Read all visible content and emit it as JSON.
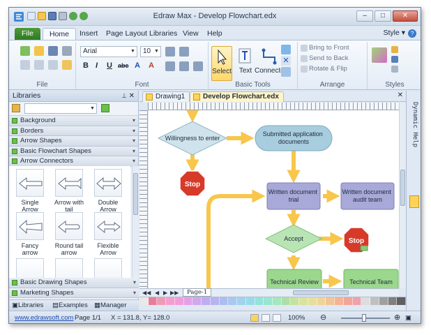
{
  "window": {
    "title": "Edraw Max - Develop Flowchart.edx",
    "controls": {
      "minimize": "–",
      "maximize": "□",
      "close": "✕"
    }
  },
  "ribbon_tabs": [
    "File",
    "Home",
    "Insert",
    "Page Layout",
    "Libraries",
    "View",
    "Help"
  ],
  "active_tab": "Home",
  "style_menu": "Style",
  "help_icon": "?",
  "ribbon": {
    "groups": {
      "file": "File",
      "font": "Font",
      "basic_tools": "Basic Tools",
      "arrange": "Arrange",
      "styles": "Styles"
    },
    "font_name": "Arial",
    "font_size": "10",
    "format_buttons": [
      "B",
      "I",
      "U",
      "abc",
      "A",
      "A"
    ],
    "tools": {
      "select": "Select",
      "text": "Text",
      "connector": "Connector"
    },
    "arrange": {
      "bring_to_front": "Bring to Front",
      "send_to_back": "Send to Back",
      "rotate_flip": "Rotate & Flip"
    }
  },
  "libraries": {
    "title": "Libraries",
    "categories_top": [
      "Background",
      "Borders",
      "Arrow Shapes",
      "Basic Flowchart Shapes",
      "Arrow Connectors"
    ],
    "shapes": [
      {
        "label": "Single Arrow"
      },
      {
        "label": "Arrow with tail"
      },
      {
        "label": "Double Arrow"
      },
      {
        "label": "Fancy arrow"
      },
      {
        "label": "Round tail arrow"
      },
      {
        "label": "Flexible Arrow"
      }
    ],
    "categories_bottom": [
      "Basic Drawing Shapes",
      "Marketing Shapes"
    ],
    "tabs": [
      "Libraries",
      "Examples",
      "Manager"
    ]
  },
  "doc_tabs": [
    "Drawing1",
    "Develop Flowchart.edx"
  ],
  "active_doc": "Develop Flowchart.edx",
  "dynamic_help": "Dynamic Help",
  "page_tab": "Page-1",
  "flowchart": {
    "nodes": {
      "willingness": "Willingness to enter",
      "submitted": "Submitted application documents",
      "stop1": "Stop",
      "written_trial": "Written document trial",
      "written_audit": "Written document audit team",
      "accept": "Accept",
      "stop2": "Stop",
      "technical_review": "Technical Review",
      "technical_team": "Technical Team"
    }
  },
  "palette_colors": [
    "#e9e9e9",
    "#e87d9a",
    "#ef9ab4",
    "#f49ecf",
    "#f29ddb",
    "#e2a1e6",
    "#d0a8ec",
    "#c0acef",
    "#b6b5f0",
    "#aebdf0",
    "#a7c8f1",
    "#9fd3ef",
    "#97dbe8",
    "#94e2dd",
    "#98e6cf",
    "#a1e8bf",
    "#addfa6",
    "#c5e2a0",
    "#d8e39e",
    "#e6df9c",
    "#efd49a",
    "#f2c496",
    "#f4b495",
    "#f3a59b",
    "#eea2aa",
    "#dddddd",
    "#c0c0c0",
    "#a0a0a0",
    "#808080",
    "#606060"
  ],
  "status": {
    "link": "www.edrawsoft.com",
    "page": "Page 1/1",
    "coords": "X = 131.8, Y= 128.0",
    "zoom": "100%"
  },
  "colors": {
    "accent_green": "#2f7a24",
    "flow_arrow": "#f8c64c",
    "node_blue": "#a8cdde",
    "node_purple": "#a8a9d8",
    "node_green": "#9bd78c",
    "stop_red": "#d83a2a"
  }
}
